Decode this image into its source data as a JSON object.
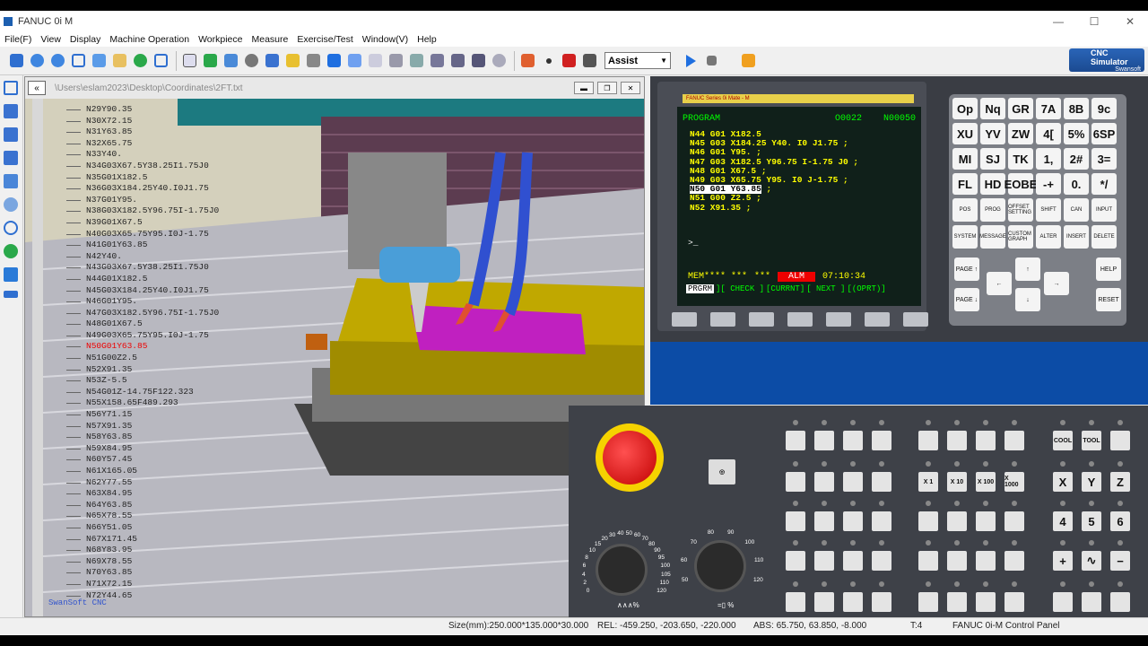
{
  "window": {
    "title": "FANUC 0i M",
    "min": "—",
    "max": "☐",
    "close": "✕"
  },
  "menu": [
    "File(F)",
    "View",
    "Display",
    "Machine Operation",
    "Workpiece",
    "Measure",
    "Exercise/Test",
    "Window(V)",
    "Help"
  ],
  "toolbar": {
    "mode_value": "Assist",
    "mode_arrow": "▼"
  },
  "logo": {
    "line1": "CNC Simulator",
    "line2": "Swansoft"
  },
  "doc": {
    "back": "«",
    "path": "\\Users\\eslam2023\\Desktop\\Coordinates\\2FT.txt",
    "controls": [
      "▬",
      "❐",
      "✕"
    ]
  },
  "nc_list": [
    "N29Y90.35",
    "N30X72.15",
    "N31Y63.85",
    "N32X65.75",
    "N33Y40.",
    "N34G03X67.5Y38.25I1.75J0",
    "N35G01X182.5",
    "N36G03X184.25Y40.I0J1.75",
    "N37G01Y95.",
    "N38G03X182.5Y96.75I-1.75J0",
    "N39G01X67.5",
    "N40G03X65.75Y95.I0J-1.75",
    "N41G01Y63.85",
    "N42Y40.",
    "N43G03X67.5Y38.25I1.75J0",
    "N44G01X182.5",
    "N45G03X184.25Y40.I0J1.75",
    "N46G01Y95.",
    "N47G03X182.5Y96.75I-1.75J0",
    "N48G01X67.5",
    "N49G03X65.75Y95.I0J-1.75",
    "N50G01Y63.85",
    "N51G00Z2.5",
    "N52X91.35",
    "N53Z-5.5",
    "N54G01Z-14.75F122.323",
    "N55X158.65F489.293",
    "N56Y71.15",
    "N57X91.35",
    "N58Y63.85",
    "N59X84.95",
    "N60Y57.45",
    "N61X165.05",
    "N62Y77.55",
    "N63X84.95",
    "N64Y63.85",
    "N65X78.55",
    "N66Y51.05",
    "N67X171.45",
    "N68Y83.95",
    "N69X78.55",
    "N70Y63.85",
    "N71X72.15",
    "N72Y44.65"
  ],
  "nc_current_index": 21,
  "watermark": "SwanSoft CNC",
  "crt": {
    "brand": "FANUC Series 0i Mate - M",
    "mode": "PROGRAM",
    "prog_no": "O0022",
    "seq_no": "N00050",
    "lines": [
      "N44 G01 X182.5",
      "N45 G03 X184.25 Y40. I0 J1.75 ;",
      "N46 G01 Y95. ;",
      "N47 G03 X182.5 Y96.75 I-1.75 J0 ;",
      "N48 G01 X67.5 ;",
      "N49 G03 X65.75 Y95. I0 J-1.75 ;",
      "N50 G01 Y63.85",
      "N51 G00 Z2.5 ;",
      "N52 X91.35 ;"
    ],
    "selected_line": 6,
    "selected_suffix": " ;",
    "cursor": ">_",
    "status_mem": "MEM**** ***",
    "status_stars": "***",
    "alarm": "ALM",
    "time": "07:10:34",
    "soft": [
      "PRGRM",
      "][ CHECK ]",
      "[CURRNT]",
      "[ NEXT ]",
      "[(OPRT)]"
    ]
  },
  "keys_row": [
    [
      "Op",
      "Nq",
      "GR",
      "7A",
      "8B",
      "9c"
    ],
    [
      "XU",
      "YV",
      "ZW",
      "4[",
      "5%",
      "6SP"
    ],
    [
      "MI",
      "SJ",
      "TK",
      "1,",
      "2#",
      "3="
    ],
    [
      "FL",
      "HD",
      "EOBE",
      "-+",
      "0.",
      "*/"
    ]
  ],
  "func_keys": [
    [
      "POS",
      "PROG",
      "OFFSET SETTING",
      "SHIFT",
      "CAN",
      "INPUT"
    ],
    [
      "SYSTEM",
      "MESSAGE",
      "CUSTOM GRAPH",
      "ALTER",
      "INSERT",
      "DELETE"
    ]
  ],
  "nav_keys": {
    "page_up": "PAGE ↑",
    "page_down": "PAGE ↓",
    "up": "↑",
    "down": "↓",
    "left": "←",
    "right": "→",
    "help": "HELP",
    "reset": "RESET"
  },
  "op_panel": {
    "jog_x1": "X 1",
    "jog_x10": "X 10",
    "jog_x100": "X 100",
    "jog_x1000": "X 1000",
    "cool": "COOL",
    "tool": "TOOL",
    "axis": [
      "X",
      "Y",
      "Z",
      "4",
      "5",
      "6"
    ],
    "plus": "+",
    "minus": "−",
    "rapid": "∿",
    "feed_scale": [
      "0",
      "2",
      "4",
      "6",
      "8",
      "10",
      "15",
      "20",
      "30",
      "40",
      "50",
      "60",
      "70",
      "80",
      "90",
      "95",
      "100",
      "105",
      "110",
      "120"
    ],
    "spindle_scale": [
      "50",
      "60",
      "70",
      "80",
      "90",
      "100",
      "110",
      "120"
    ],
    "feed_label": "∧∧∧%",
    "spindle_label": "=▯ %"
  },
  "statusbar": {
    "size": "Size(mm):250.000*135.000*30.000",
    "rel": "REL:  -459.250,  -203.650,  -220.000",
    "abs": "ABS:  65.750,   63.850,    -8.000",
    "tool": "T:4",
    "panel": "FANUC 0i-M Control Panel"
  },
  "colors": {
    "crt_text": "#ffff00",
    "crt_bg": "#10201a",
    "alarm": "#e00000",
    "accent": "#1c5fb0"
  }
}
